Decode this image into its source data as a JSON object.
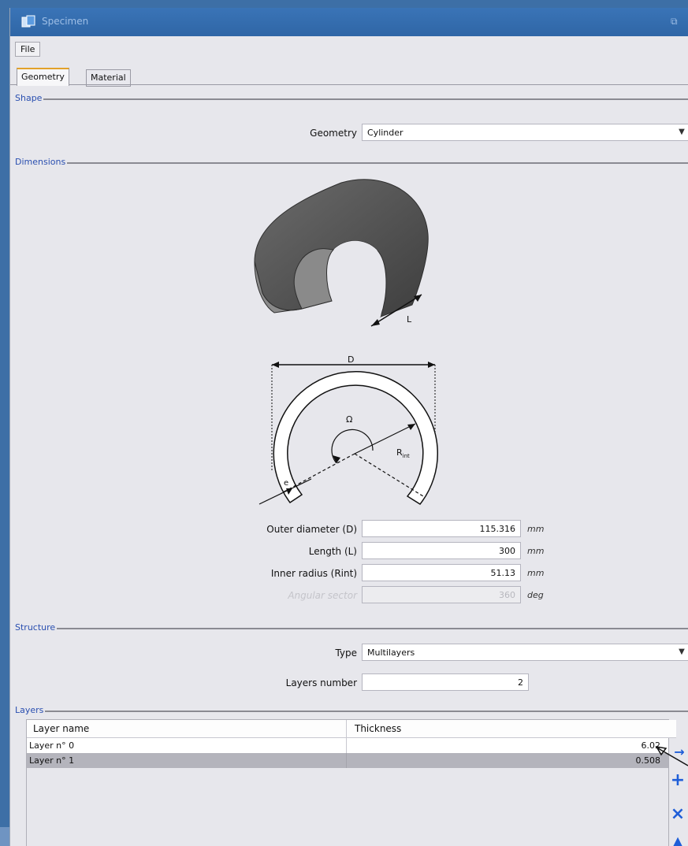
{
  "window": {
    "title": "Specimen"
  },
  "menu": {
    "file": "File"
  },
  "tabs": [
    {
      "label": "Geometry",
      "active": true
    },
    {
      "label": "Material",
      "active": false
    }
  ],
  "shape": {
    "section": "Shape",
    "geometry_label": "Geometry",
    "geometry_value": "Cylinder"
  },
  "dimensions": {
    "section": "Dimensions",
    "diagram_labels": {
      "L": "L",
      "D": "D",
      "omega": "Ω",
      "rint": "R",
      "rint_sub": "int",
      "e": "e"
    },
    "outer_diameter": {
      "label": "Outer diameter (D)",
      "value": "115.316",
      "unit": "mm"
    },
    "length": {
      "label": "Length (L)",
      "value": "300",
      "unit": "mm"
    },
    "inner_radius": {
      "label": "Inner radius (Rint)",
      "value": "51.13",
      "unit": "mm"
    },
    "angular_sector": {
      "label": "Angular sector",
      "value": "360",
      "unit": "deg"
    }
  },
  "structure": {
    "section": "Structure",
    "type_label": "Type",
    "type_value": "Multilayers",
    "layers_number_label": "Layers number",
    "layers_number_value": "2"
  },
  "layers": {
    "section": "Layers",
    "columns": [
      "Layer name",
      "Thickness"
    ],
    "rows": [
      {
        "name": "Layer n° 0",
        "thickness": "6.02"
      },
      {
        "name": "Layer n° 1",
        "thickness": "0.508"
      }
    ]
  },
  "icons": {
    "side_buttons": [
      "arrow-right-icon",
      "add-icon",
      "delete-icon",
      "arrow-up-icon"
    ],
    "accent": "#1f5ed8"
  }
}
